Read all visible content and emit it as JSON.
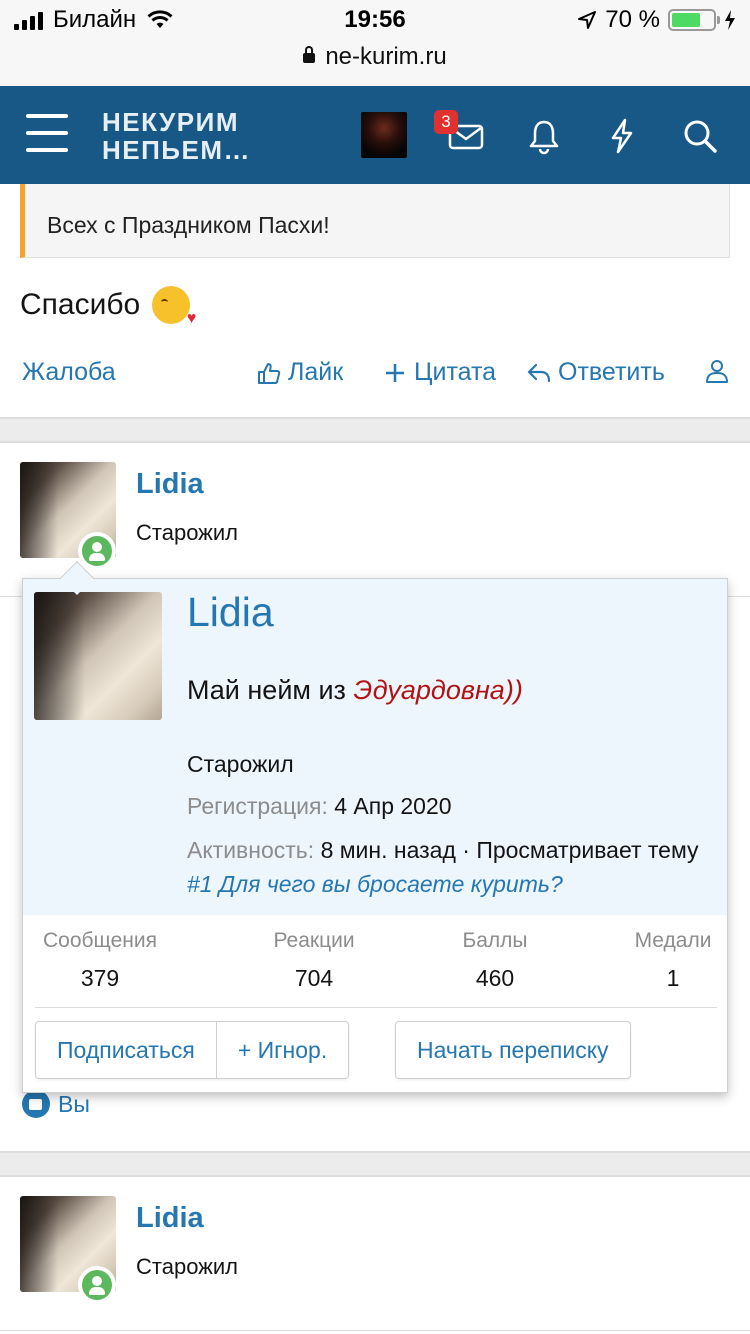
{
  "status_bar": {
    "carrier": "Билайн",
    "time": "19:56",
    "battery": "70 %",
    "battery_level": 0.7
  },
  "browser": {
    "url": "ne-kurim.ru"
  },
  "header": {
    "logo_line1": "НЕКУРИМ",
    "logo_line2": "НЕПЬЕМ…",
    "messages_badge": "3",
    "icons": [
      "menu-icon",
      "avatar",
      "envelope-icon",
      "bell-icon",
      "lightning-icon",
      "search-icon"
    ]
  },
  "post": {
    "quote_text": "Всех с Праздником Пасхи!",
    "text": "Спасибо",
    "emoji": "kissing-heart-emoji",
    "actions": {
      "report": "Жалоба",
      "like": "Лайк",
      "quote": "Цитата",
      "reply": "Ответить"
    }
  },
  "post2": {
    "username": "Lidia",
    "user_title": "Старожил",
    "likes_text": "Вы"
  },
  "post3": {
    "username": "Lidia",
    "user_title": "Старожил"
  },
  "member_card": {
    "name": "Lidia",
    "status_prefix": "Май нейм из ",
    "status_highlight": "Эдуардовна))",
    "user_title": "Старожил",
    "registration_label": "Регистрация:",
    "registration_value": "4 Апр 2020",
    "activity_label": "Активность:",
    "activity_value": "8 мин. назад · Просматривает тему",
    "activity_link": "#1 Для чего вы бросаете курить?",
    "stats": [
      {
        "label": "Сообщения",
        "value": "379"
      },
      {
        "label": "Реакции",
        "value": "704"
      },
      {
        "label": "Баллы",
        "value": "460"
      },
      {
        "label": "Медали",
        "value": "1"
      }
    ],
    "buttons": {
      "follow": "Подписаться",
      "ignore": "+ Игнор.",
      "start_conversation": "Начать переписку"
    }
  },
  "colors": {
    "header_bg": "#185886",
    "link": "#2577b1",
    "quote_accent": "#f4a12e",
    "card_bg": "#edf5fd",
    "online": "#5cb85c",
    "badge": "#e03030",
    "status_highlight": "#b01313"
  }
}
